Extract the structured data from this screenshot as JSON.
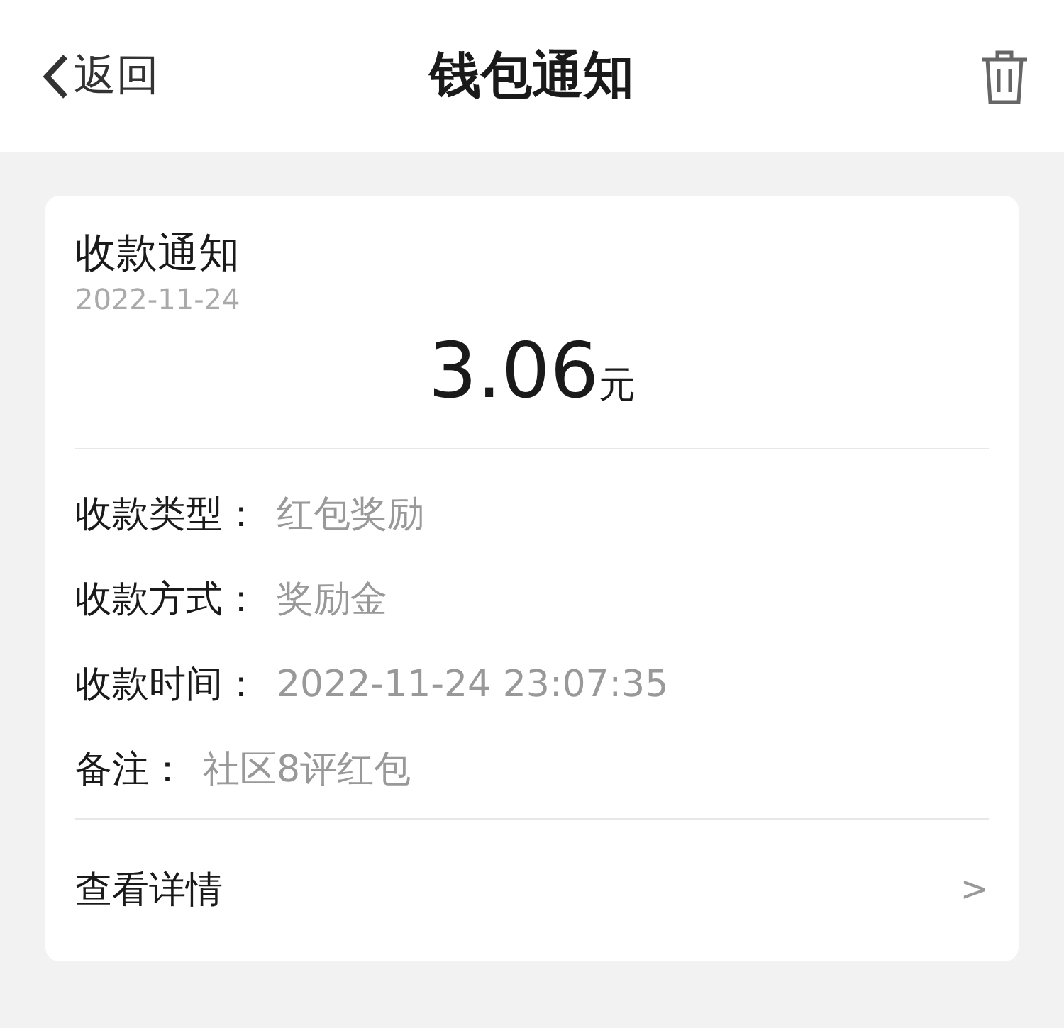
{
  "nav": {
    "back": "返回",
    "title": "钱包通知"
  },
  "card": {
    "title": "收款通知",
    "date": "2022-11-24",
    "amount": "3.06",
    "unit": "元",
    "rows": [
      {
        "label": "收款类型：",
        "value": "红包奖励"
      },
      {
        "label": "收款方式：",
        "value": "奖励金"
      },
      {
        "label": "收款时间：",
        "value": "2022-11-24 23:07:35"
      },
      {
        "label": "备注：",
        "value": "社区8评红包"
      }
    ],
    "details": {
      "label": "查看详情",
      "chevron": ">"
    }
  }
}
